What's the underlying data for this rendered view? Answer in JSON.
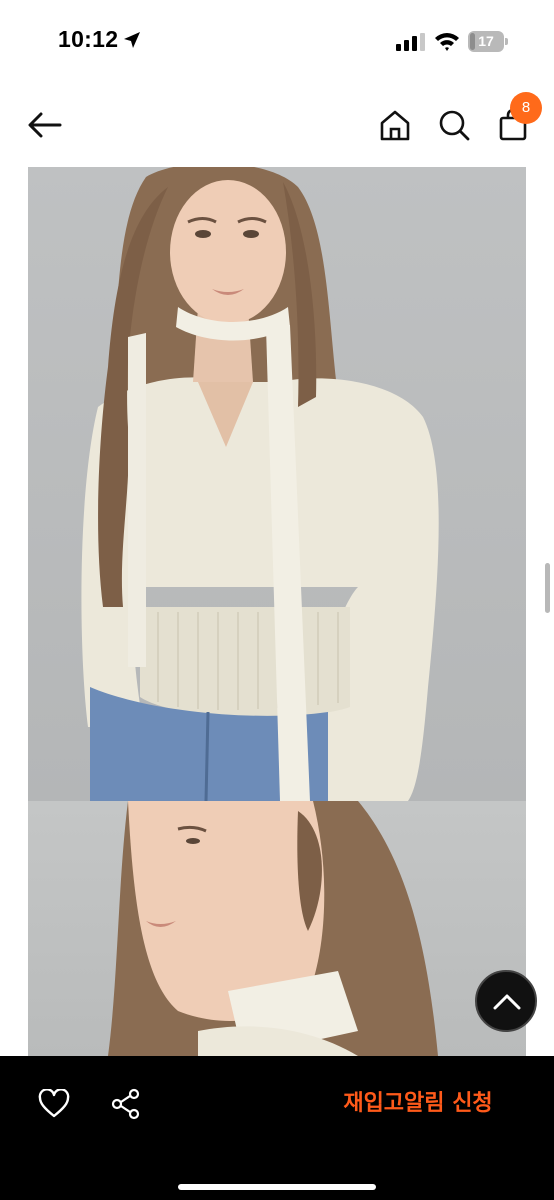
{
  "status_bar": {
    "time": "10:12",
    "battery_level": "17",
    "battery_fraction": 0.17,
    "icons": [
      "location-arrow-icon",
      "cellular-signal-icon",
      "wifi-icon",
      "battery-icon"
    ]
  },
  "nav": {
    "icons": [
      "back-arrow-icon",
      "home-icon",
      "search-icon",
      "shopping-bag-icon"
    ],
    "cart_count": "8",
    "badge_color": "#ff6a1a"
  },
  "product_images": [
    {
      "description_icon": "product-photo-1"
    },
    {
      "description_icon": "product-photo-2"
    }
  ],
  "bottom_bar": {
    "icons": [
      "heart-icon",
      "share-icon"
    ],
    "restock_label": "재입고알림 신청",
    "accent_color": "#ff5a1a"
  },
  "scroll_top": {
    "icon": "chevron-up-icon"
  }
}
